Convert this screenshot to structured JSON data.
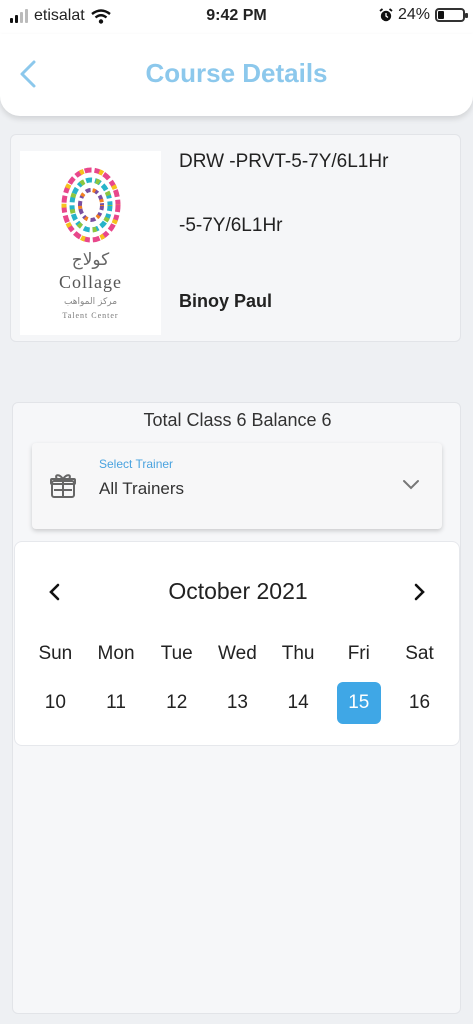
{
  "status_bar": {
    "carrier": "etisalat",
    "time": "9:42 PM",
    "battery": "24%",
    "battery_level": 0.24
  },
  "header": {
    "title": "Course Details",
    "back_icon": "chevron-left-icon"
  },
  "course": {
    "logo": {
      "arabic_name": "كولاج",
      "name": "Collage",
      "arabic_subtitle": "مركز المواهب",
      "subtitle": "Talent Center"
    },
    "code": "DRW -PRVT-5-7Y/6L1Hr",
    "subtitle": "-5-7Y/6L1Hr",
    "trainer": "Binoy Paul"
  },
  "schedule": {
    "total_line": "Total Class  6 Balance  6",
    "trainer_select": {
      "label": "Select Trainer",
      "value": "All Trainers",
      "icon": "gift-icon"
    },
    "calendar": {
      "month": "October 2021",
      "days": [
        "Sun",
        "Mon",
        "Tue",
        "Wed",
        "Thu",
        "Fri",
        "Sat"
      ],
      "dates": [
        "10",
        "11",
        "12",
        "13",
        "14",
        "15",
        "16"
      ],
      "selected": "15"
    }
  },
  "colors": {
    "accent": "#3fa7e6",
    "title": "#8cc8ec"
  }
}
